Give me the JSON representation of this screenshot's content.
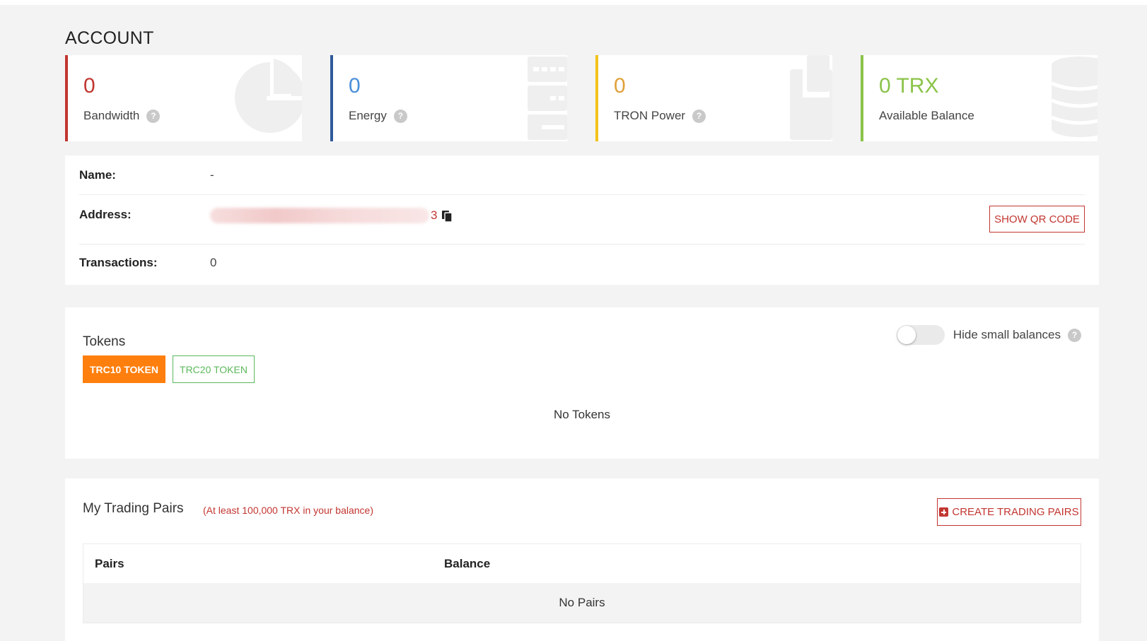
{
  "page": {
    "title": "ACCOUNT"
  },
  "stats": [
    {
      "value": "0",
      "label": "Bandwidth",
      "has_help": true,
      "color": "#c23631",
      "icon": "pie-chart-icon"
    },
    {
      "value": "0",
      "label": "Energy",
      "has_help": true,
      "color": "#4a8fd8",
      "icon": "server-icon"
    },
    {
      "value": "0",
      "label": "TRON Power",
      "has_help": true,
      "color": "#e0a13a",
      "icon": "power-icon"
    },
    {
      "value": "0 TRX",
      "label": "Available Balance",
      "has_help": false,
      "color": "#8bc34a",
      "icon": "database-icon"
    }
  ],
  "help_glyph": "?",
  "info": {
    "name_label": "Name:",
    "name_value": "-",
    "address_label": "Address:",
    "address_tail": "3",
    "qr_button": "SHOW QR CODE",
    "transactions_label": "Transactions:",
    "transactions_value": "0"
  },
  "tokens": {
    "title": "Tokens",
    "tabs": [
      "TRC10 TOKEN",
      "TRC20 TOKEN"
    ],
    "active_tab": "TRC10 TOKEN",
    "toggle_label": "Hide small balances",
    "toggle_on": false,
    "empty_text": "No Tokens"
  },
  "pairs": {
    "title": "My Trading Pairs",
    "note": "(At least 100,000 TRX in your balance)",
    "create_button": "CREATE TRADING PAIRS",
    "columns": [
      "Pairs",
      "Balance"
    ],
    "empty_text": "No Pairs"
  },
  "colors": {
    "brand_red": "#c23631",
    "accent_orange": "#ff7f0e",
    "accent_green": "#5cb85c"
  }
}
